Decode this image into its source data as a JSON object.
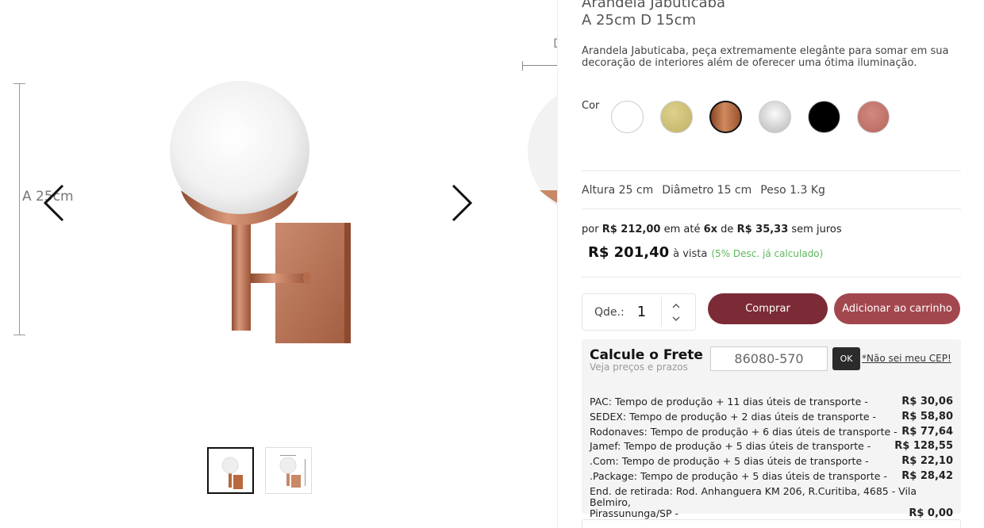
{
  "gallery": {
    "dimension_label": "A 25cm",
    "thumbnails": [
      {
        "name": "thumbnail-1",
        "active": true
      },
      {
        "name": "thumbnail-2",
        "active": false
      }
    ]
  },
  "product": {
    "title": "Arandela Jabuticaba",
    "subtitle": "A 25cm D 15cm",
    "description": "Arandela Jabuticaba, peça extremamente elegânte para somar em sua decoração de interiores além de oferecer uma ótima iluminação.",
    "color_label": "Cor",
    "colors": [
      {
        "name": "white",
        "hex": "#ffffff",
        "selected": false
      },
      {
        "name": "gold",
        "hex": "#cdbf72",
        "selected": false
      },
      {
        "name": "copper",
        "hex": "#b8683c",
        "selected": true
      },
      {
        "name": "chrome",
        "hex": "#cfcfcf",
        "selected": false
      },
      {
        "name": "black",
        "hex": "#000000",
        "selected": false
      },
      {
        "name": "rose",
        "hex": "#c6736a",
        "selected": false
      }
    ],
    "specs": {
      "height": "Altura 25 cm",
      "diameter": "Diâmetro 15 cm",
      "weight": "Peso 1.3 Kg"
    }
  },
  "pricing": {
    "prefix": "por",
    "price": "R$ 212,00",
    "mid": "em até",
    "installments": "6x",
    "of": "de",
    "installment_value": "R$ 35,33",
    "suffix": "sem juros",
    "cash_price": "R$ 201,40",
    "cash_label": "à vista",
    "cash_note": "(5% Desc. já calculado)"
  },
  "purchase": {
    "qty_label": "Qde.:",
    "qty_value": "1",
    "buy_label": "Comprar",
    "cart_label": "Adicionar ao carrinho"
  },
  "freight": {
    "title": "Calcule o Frete",
    "subtitle": "Veja preços e prazos",
    "cep_value": "86080-570",
    "ok_label": "OK",
    "cep_link": "*Não sei meu CEP!",
    "options": [
      {
        "name": "PAC: Tempo de produção + 11 dias úteis de transporte -",
        "price": "R$ 30,06"
      },
      {
        "name": "SEDEX: Tempo de produção + 2 dias úteis de transporte -",
        "price": "R$ 58,80"
      },
      {
        "name": "Rodonaves: Tempo de produção + 6 dias úteis de transporte -",
        "price": "R$ 77,64"
      },
      {
        "name": "Jamef: Tempo de produção + 5 dias úteis de transporte -",
        "price": "R$ 128,55"
      },
      {
        "name": ".Com: Tempo de produção + 5 dias úteis de transporte -",
        "price": "R$ 22,10"
      },
      {
        "name": ".Package: Tempo de produção + 5 dias úteis de transporte -",
        "price": "R$ 28,42"
      }
    ],
    "pickup_line1": "End. de retirada: Rod. Anhanguera KM 206, R.Curitiba, 4685 - Vila Belmiro,",
    "pickup_line2": "Pirassununga/SP -",
    "pickup_price": "R$ 0,00"
  }
}
